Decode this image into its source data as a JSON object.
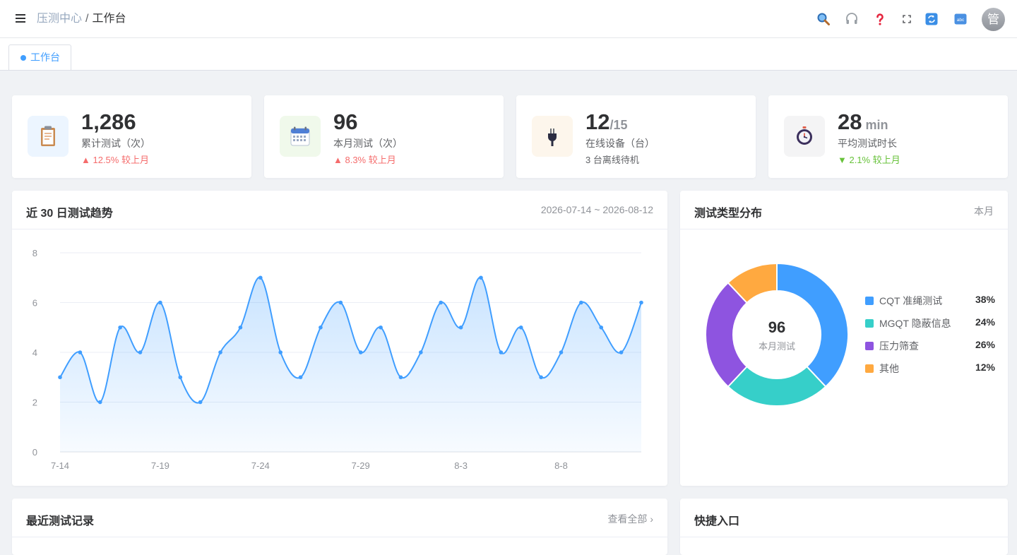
{
  "header": {
    "breadcrumb": [
      "压测中心",
      "工作台"
    ],
    "breadcrumb_sep": "/",
    "avatar_text": "管",
    "tools": [
      "search-icon",
      "headset-icon",
      "help-icon",
      "fullscreen-icon",
      "refresh-icon",
      "font-size-icon"
    ]
  },
  "tabs": [
    {
      "label": "工作台",
      "active": true
    }
  ],
  "stats": [
    {
      "value": "1,286",
      "suffix": "",
      "label": "累计测试（次）",
      "sub": "▲ 12.5% 较上月",
      "sub_tone": "up",
      "icon": "clipboard-icon"
    },
    {
      "value": "96",
      "suffix": "",
      "label": "本月测试（次）",
      "sub": "▲ 8.3% 较上月",
      "sub_tone": "up",
      "icon": "calendar-icon"
    },
    {
      "value": "12",
      "suffix": "/15",
      "label": "在线设备（台）",
      "sub": "3 台离线待机",
      "sub_tone": "muted",
      "icon": "plug-icon"
    },
    {
      "value": "28",
      "suffix": " min",
      "label": "平均测试时长",
      "sub": "▼ 2.1% 较上月",
      "sub_tone": "down",
      "icon": "stopwatch-icon"
    }
  ],
  "trend": {
    "title": "近 30 日测试趋势",
    "range": "2026-07-14 ~ 2026-08-12"
  },
  "pie": {
    "title": "测试类型分布",
    "period": "本月",
    "center_value": "96",
    "center_label": "本月测试"
  },
  "recent": {
    "title": "最近测试记录",
    "link": "查看全部 ›"
  },
  "quick": {
    "title": "快捷入口"
  },
  "colors": {
    "primary": "#409eff",
    "teal": "#36cfc9",
    "purple": "#8e54e0",
    "orange": "#ffa940",
    "up": "#f56c6c",
    "down": "#67c23a"
  },
  "chart_data": [
    {
      "type": "area",
      "title": "",
      "xlabel": "",
      "ylabel": "",
      "x": [
        "7-14",
        "7-15",
        "7-16",
        "7-17",
        "7-18",
        "7-19",
        "7-20",
        "7-21",
        "7-22",
        "7-23",
        "7-24",
        "7-25",
        "7-26",
        "7-27",
        "7-28",
        "7-29",
        "7-30",
        "7-31",
        "8-1",
        "8-2",
        "8-3",
        "8-4",
        "8-5",
        "8-6",
        "8-7",
        "8-8",
        "8-9",
        "8-10",
        "8-11",
        "8-12"
      ],
      "x_tick_labels": [
        "7-14",
        "7-19",
        "7-24",
        "7-29",
        "8-3",
        "8-8"
      ],
      "y_ticks": [
        0,
        2,
        4,
        6,
        8
      ],
      "ylim": [
        0,
        8
      ],
      "series": [
        {
          "values": [
            3,
            4,
            2,
            5,
            4,
            6,
            3,
            2,
            4,
            5,
            7,
            4,
            3,
            5,
            6,
            4,
            5,
            3,
            4,
            6,
            5,
            7,
            4,
            5,
            3,
            4,
            6,
            5,
            4,
            6
          ]
        }
      ],
      "grid": true,
      "smooth": true
    },
    {
      "type": "pie",
      "donut": true,
      "categories": [
        "CQT 准绳测试",
        "MGQT 隐蔽信息",
        "压力筛查",
        "其他"
      ],
      "values": [
        38,
        24,
        26,
        12
      ],
      "value_labels": [
        "38%",
        "24%",
        "26%",
        "12%"
      ],
      "colors": [
        "#409eff",
        "#36cfc9",
        "#8e54e0",
        "#ffa940"
      ],
      "legend": "right"
    }
  ]
}
